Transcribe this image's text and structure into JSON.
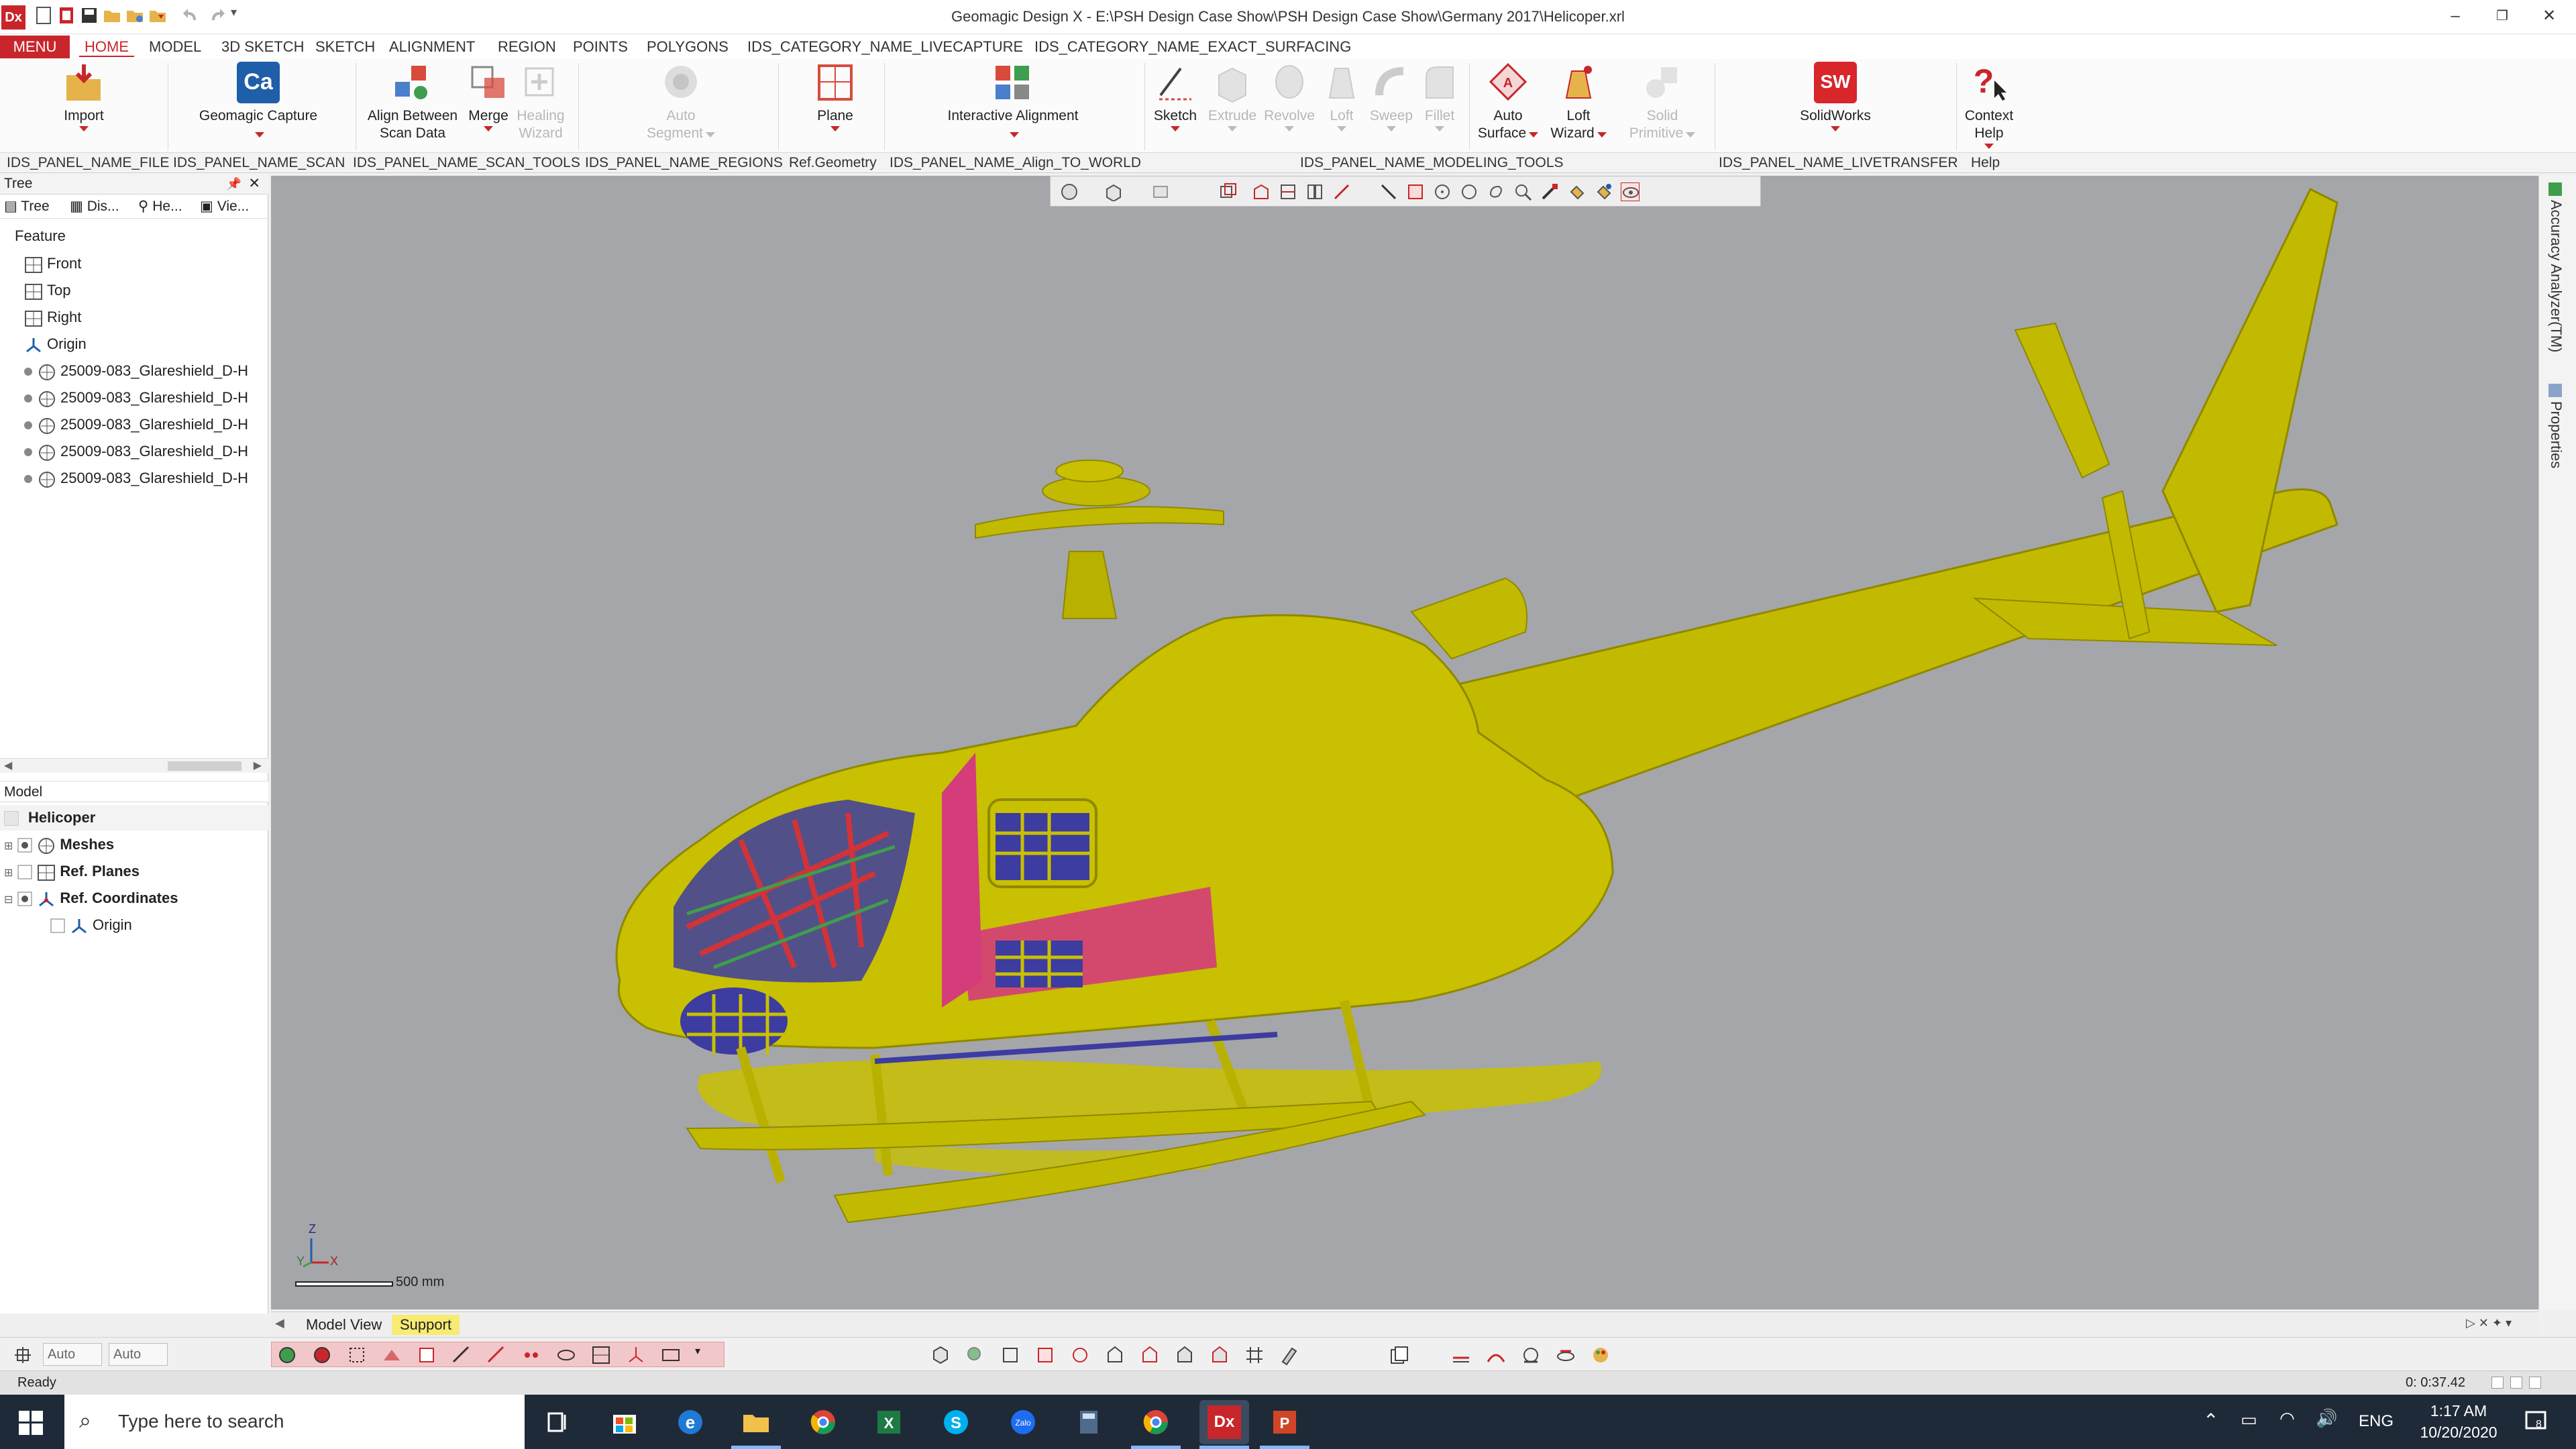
{
  "window": {
    "title": "Geomagic Design X - E:\\PSH Design Case Show\\PSH Design Case Show\\Germany 2017\\Helicoper.xrl",
    "app_icon": "Dx"
  },
  "menubar": {
    "items": [
      "MENU",
      "HOME",
      "MODEL",
      "3D SKETCH",
      "SKETCH",
      "ALIGNMENT",
      "REGION",
      "POINTS",
      "POLYGONS",
      "IDS_CATEGORY_NAME_LIVECAPTURE",
      "IDS_CATEGORY_NAME_EXACT_SURFACING"
    ],
    "active": "HOME"
  },
  "ribbon": {
    "buttons": [
      {
        "label": "Import"
      },
      {
        "label": "Geomagic Capture",
        "icon_text": "Ca"
      },
      {
        "label": "Align Between Scan Data"
      },
      {
        "label": "Merge"
      },
      {
        "label": "Healing Wizard"
      },
      {
        "label": "Auto Segment"
      },
      {
        "label": "Plane"
      },
      {
        "label": "Interactive Alignment"
      },
      {
        "label": "Sketch"
      },
      {
        "label": "Extrude"
      },
      {
        "label": "Revolve"
      },
      {
        "label": "Loft"
      },
      {
        "label": "Sweep"
      },
      {
        "label": "Fillet"
      },
      {
        "label": "Auto Surface"
      },
      {
        "label": "Loft Wizard"
      },
      {
        "label": "Solid Primitive"
      },
      {
        "label": "SolidWorks",
        "icon_text": "SW"
      },
      {
        "label": "Context Help"
      }
    ]
  },
  "panels": [
    "IDS_PANEL_NAME_FILE",
    "IDS_PANEL_NAME_SCAN",
    "IDS_PANEL_NAME_SCAN_TOOLS",
    "IDS_PANEL_NAME_REGIONS",
    "Ref.Geometry",
    "IDS_PANEL_NAME_Align_TO_WORLD",
    "IDS_PANEL_NAME_MODELING_TOOLS",
    "IDS_PANEL_NAME_LIVETRANSFER",
    "Help"
  ],
  "tree_panel": {
    "title": "Tree",
    "tabs": [
      "Tree",
      "Dis...",
      "He...",
      "Vie..."
    ],
    "section": "Feature",
    "items": [
      "Front",
      "Top",
      "Right",
      "Origin",
      "25009-083_Glareshield_D-H",
      "25009-083_Glareshield_D-H",
      "25009-083_Glareshield_D-H",
      "25009-083_Glareshield_D-H",
      "25009-083_Glareshield_D-H"
    ]
  },
  "model_panel": {
    "title": "Model",
    "root": "Helicoper",
    "items": [
      "Meshes",
      "Ref. Planes",
      "Ref. Coordinates",
      "Origin"
    ]
  },
  "viewport": {
    "scale_label": "500 mm",
    "axes": [
      "Z",
      "Y",
      "X"
    ],
    "background": "#a5a6aa",
    "model_color": "#c8c000"
  },
  "right_strip": {
    "tabs": [
      "Accuracy Analyzer(TM)",
      "Properties"
    ]
  },
  "bottom_tabs": {
    "tabs": [
      "Model View",
      "Support"
    ],
    "active": "Support"
  },
  "bottom_toolbar": {
    "combo1": "Auto",
    "combo2": "Auto"
  },
  "status": {
    "text": "Ready",
    "time": "0: 0:37.42"
  },
  "taskbar": {
    "search_placeholder": "Type here to search",
    "lang": "ENG",
    "clock_time": "1:17 AM",
    "clock_date": "10/20/2020",
    "notification_count": "8"
  }
}
